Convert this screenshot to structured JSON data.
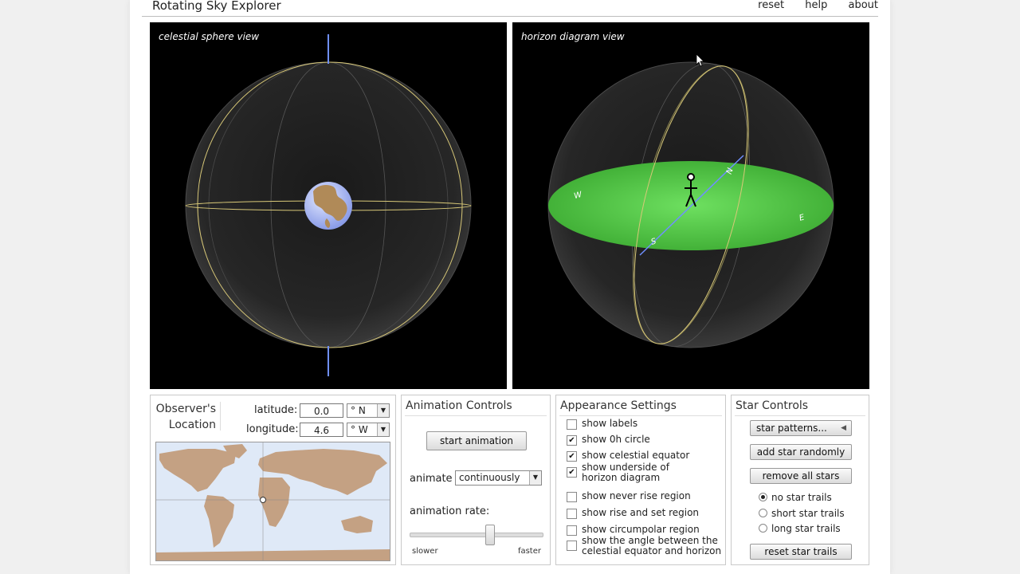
{
  "app": {
    "title": "Rotating Sky Explorer",
    "menu": {
      "reset": "reset",
      "help": "help",
      "about": "about"
    }
  },
  "views": {
    "left": {
      "label": "celestial sphere view"
    },
    "right": {
      "label": "horizon diagram view",
      "compass": {
        "n": "N",
        "e": "E",
        "s": "S",
        "w": "W"
      }
    }
  },
  "observer": {
    "title_line1": "Observer's",
    "title_line2": "Location",
    "latitude_label": "latitude:",
    "latitude_value": "0.0",
    "latitude_dir": "° N",
    "longitude_label": "longitude:",
    "longitude_value": "4.6",
    "longitude_dir": "° W"
  },
  "animation": {
    "title": "Animation Controls",
    "start_button": "start animation",
    "animate_label": "animate",
    "animate_value": "continuously",
    "rate_label": "animation rate:",
    "slower": "slower",
    "faster": "faster",
    "rate_fraction": 0.6
  },
  "appearance": {
    "title": "Appearance Settings",
    "options": [
      {
        "label": "show labels",
        "checked": false
      },
      {
        "label": "show 0h circle",
        "checked": true
      },
      {
        "label": "show celestial equator",
        "checked": true
      },
      {
        "label": "show underside of\nhorizon diagram",
        "checked": true
      },
      {
        "label": "show never rise region",
        "checked": false
      },
      {
        "label": "show rise and set region",
        "checked": false
      },
      {
        "label": "show circumpolar region",
        "checked": false
      },
      {
        "label": "show the angle between the\ncelestial equator and horizon",
        "checked": false
      }
    ]
  },
  "stars": {
    "title": "Star Controls",
    "patterns_button": "star patterns...",
    "add_button": "add star randomly",
    "remove_button": "remove all stars",
    "trail_options": [
      {
        "label": "no star trails",
        "selected": true
      },
      {
        "label": "short star trails",
        "selected": false
      },
      {
        "label": "long star trails",
        "selected": false
      }
    ],
    "reset_button": "reset star trails"
  },
  "colors": {
    "horizon_plane": "#4ec240",
    "axis": "#6f8fff",
    "circle": "#d8c878",
    "land": "#c4a183",
    "ocean": "#dfe9f7"
  }
}
